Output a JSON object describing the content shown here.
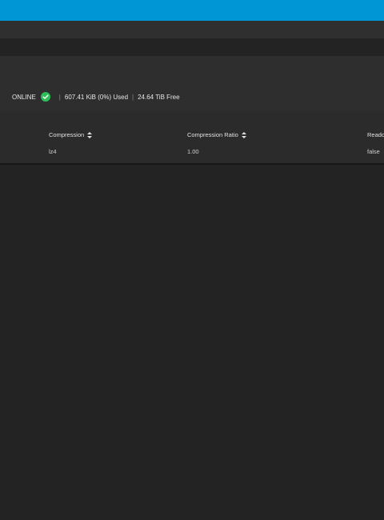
{
  "pool": {
    "status": "ONLINE",
    "used": "607.41 KiB (0%) Used",
    "free": "24.64 TiB Free",
    "separator": "|"
  },
  "table": {
    "columns": [
      {
        "label": "Compression"
      },
      {
        "label": "Compression Ratio"
      },
      {
        "label": "Reado"
      }
    ],
    "rows": [
      {
        "compression": "lz4",
        "compression_ratio": "1.00",
        "readonly": "false"
      }
    ]
  },
  "colors": {
    "topbar": "#0095d5",
    "status_ok": "#2ebd59"
  },
  "icons": {
    "status": "check-circle-icon",
    "sort": "sort-icon"
  }
}
